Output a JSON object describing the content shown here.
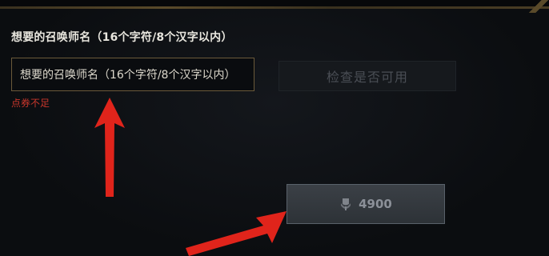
{
  "form": {
    "label": "想要的召唤师名（16个字符/8个汉字以内）",
    "input_value": "想要的召唤师名（16个字符/8个汉字以内）",
    "error": "点券不足",
    "check_button": "检查是否可用"
  },
  "purchase": {
    "icon": "rp-coin-icon",
    "price": "4900"
  },
  "colors": {
    "error": "#c7362b",
    "arrow": "#e0241b",
    "input_border": "#6b5a3a"
  }
}
